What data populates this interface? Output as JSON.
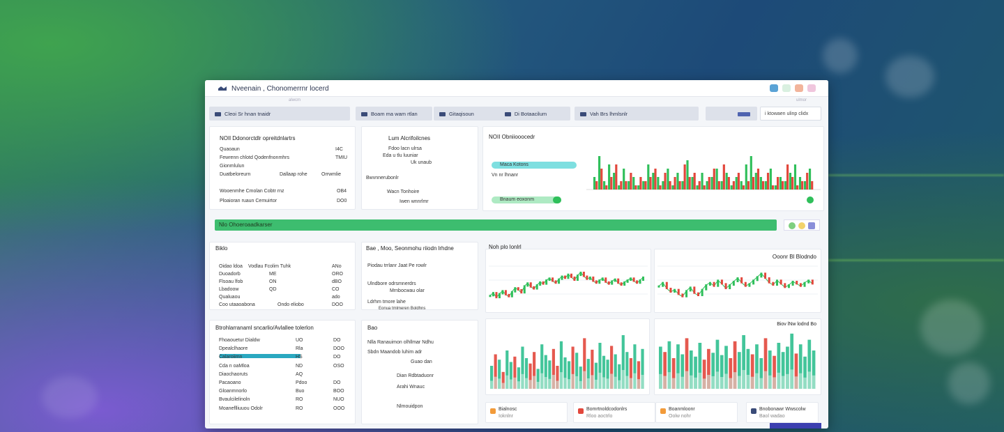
{
  "window": {
    "title": "Nveenain , Chonomerrnr locerd",
    "subtab_left": "alwcm",
    "subtab_right": "ulmor"
  },
  "navbar": {
    "items": [
      "Cleoi Sr hnan tnaidr",
      "Boam ma wam rtlan",
      "Gitaqisoun",
      "Di Botaacilum",
      "Vah Brs lhmlsnlr"
    ],
    "search_placeholder": "i ktowaen ulinp clidx"
  },
  "panel_overview": {
    "title": "NOIl Ddonorctdlr opreitdnlartrs",
    "rows": [
      {
        "label": "Quaoaun",
        "value": "I4C"
      },
      {
        "label": "Fewrenn chlotd Qodenfnonmhrs",
        "value": "TMIU"
      },
      {
        "label": "Gionmlulun",
        "value": ""
      },
      {
        "label": "Duatbeloreurn",
        "value": ""
      },
      {
        "label": "Dallaap rohe",
        "value": "Orrwmlie"
      },
      {
        "label": "Wooenmhe Cmolan Cobtr rnz",
        "value": "OB4"
      },
      {
        "label": "Ploaioran ruaun Cemuirtor",
        "value": "DO0"
      }
    ]
  },
  "panel_mid_top": {
    "title": "Lum Alcrifoilcnes",
    "rows": [
      "Fdoo lacn ulrsa",
      "Eda u tlu luuniar",
      "Uk unaub",
      "Bwvnnerubonlr",
      "Wacn Tonhoire",
      "Iwen wnnrlmr"
    ]
  },
  "panel_chart_top": {
    "title": "NOII Obniiooocedr",
    "tags": [
      "Maca Kotons",
      "Vn nr lhnanr",
      "Bnaum eoxonm"
    ]
  },
  "progress": {
    "label": "Nlo Ohoeroaadkarser",
    "percent": 100
  },
  "panel_left_mid": {
    "title": "Biklo",
    "rows": [
      {
        "label": "Oidao ldoa",
        "v1": "Vodlau Fcolim Tuhk",
        "v2": "ANo"
      },
      {
        "label": "Duoadorb",
        "v1": "ME",
        "v2": "ORO"
      },
      {
        "label": "Flsoau lfob",
        "v1": "ON",
        "v2": "dBO"
      },
      {
        "label": "Lbadoow",
        "v1": "QD",
        "v2": "CO"
      },
      {
        "label": "Qualuaou",
        "v1": "",
        "v2": "ado"
      },
      {
        "label": "Coo utaaoabona",
        "v1": "Ondo eliobo",
        "v2": "DOO"
      }
    ]
  },
  "panel_mid_mid": {
    "title": "Bae , Moo, Seonmohu riiodn lrhdne",
    "rows": [
      "Piodau trrlanr Jaat Pe rowlr",
      "Ulndbore odrsmnerdrs",
      "Mrnbocwau olar",
      "Ldrhm tmore lahe",
      "Eonua tmlmeren Boldhns"
    ]
  },
  "chart_candles_title": "Noh plo lonlrl",
  "chart_candles_right_label": "Ooonr Bl Blodndo",
  "chart_bars_right_label": "Biov lNw lodnd Bo",
  "panel_left_bottom": {
    "title": "Btrohlarranaml sncarlio/Avlallee tolerlon",
    "rows": [
      {
        "label": "Fhoaouetur Dialdw",
        "v1": "UO",
        "v2": "DO"
      },
      {
        "label": "Dpealclhaore",
        "v1": "Rla",
        "v2": "DOO"
      },
      {
        "label": "Calaroiimn",
        "v1": "HS",
        "v2": "DO"
      },
      {
        "label": "Cda n oaMloa",
        "v1": "ND",
        "v2": "OSO"
      },
      {
        "label": "Diaochaoruts",
        "v1": "AQ",
        "v2": ""
      },
      {
        "label": "Pacaoano",
        "v1": "Pdoo",
        "v2": "DO"
      },
      {
        "label": "Gloanmnorlo",
        "v1": "Buo",
        "v2": "BOO"
      },
      {
        "label": "Bvaulcilelinoln",
        "v1": "RO",
        "v2": "NUO"
      },
      {
        "label": "Moaneflliuuou Odolr",
        "v1": "RO",
        "v2": "OOO"
      }
    ]
  },
  "panel_mid_bottom": {
    "title": "Bao",
    "rows": [
      "Nlla Ranauimon olhllmar Ndhu",
      "Sbdn Maandob luhim adr",
      "Guao dan",
      "Dian Rdbtaduonr",
      "Arahi Wnauc",
      "Nlmouidpon"
    ]
  },
  "bottom_tiles": [
    {
      "label": "Bialnosc",
      "sub": "Ioknlnr"
    },
    {
      "label": "Bomrtnoldcodonlrs",
      "sub": "Rloo aoctrlo"
    },
    {
      "label": "Boanmloonr",
      "sub": "Oolw nohr"
    },
    {
      "label": "Bnobonawr Wwscolw",
      "sub": "Baol wadao"
    }
  ],
  "colors": {
    "accent_green": "#2fbf5a",
    "accent_red": "#e2473c",
    "accent_teal": "#42c6c9",
    "navbar_bg": "#dde1ea"
  },
  "chart_data": [
    {
      "type": "bar",
      "title": "NOII Obniiooocedr",
      "series": [
        {
          "values": [
            3,
            8,
            2,
            6,
            4,
            1,
            5,
            2,
            3,
            1,
            2,
            6,
            4,
            3,
            2,
            5,
            1,
            4,
            2,
            7,
            3,
            1,
            4,
            2,
            3,
            5,
            2,
            4,
            1,
            3,
            2,
            6,
            8,
            4,
            3,
            2,
            5,
            1,
            3,
            2,
            4,
            6,
            3,
            2,
            5
          ]
        },
        {
          "values": [
            2,
            5,
            1,
            3,
            6,
            2,
            2,
            4,
            1,
            3,
            2,
            3,
            5,
            1,
            4,
            2,
            3,
            2,
            6,
            3,
            4,
            2,
            1,
            3,
            5,
            2,
            6,
            3,
            2,
            4,
            1,
            2,
            3,
            5,
            2,
            4,
            1,
            3,
            2,
            6,
            3,
            1,
            2,
            4,
            2
          ]
        }
      ],
      "colors": [
        "#2fbf5a",
        "#e2473c"
      ]
    },
    {
      "type": "line",
      "title": "Noh plo lonlrl",
      "values": [
        42,
        45,
        40,
        44,
        47,
        43,
        41,
        46,
        50,
        48,
        45,
        52,
        55,
        51,
        49,
        53,
        56,
        54,
        58,
        60,
        57,
        55,
        59,
        62,
        60,
        64,
        61,
        58,
        63,
        66,
        62,
        59,
        61,
        57,
        55,
        58,
        60,
        56,
        54,
        57,
        59,
        55,
        53,
        56,
        58,
        60,
        57,
        55,
        58,
        61
      ]
    },
    {
      "type": "line",
      "title": "Ooonr Bl Blodndo",
      "values": [
        55,
        58,
        53,
        50,
        52,
        48,
        46,
        51,
        54,
        49,
        47,
        52,
        56,
        58,
        55,
        60,
        57,
        53,
        56,
        59,
        62,
        58,
        55,
        57,
        60,
        63,
        66,
        62,
        58,
        56,
        60,
        57,
        54,
        56,
        59,
        57,
        55,
        58,
        60,
        57
      ]
    },
    {
      "type": "bar",
      "title": "",
      "values": [
        30,
        45,
        38,
        22,
        50,
        35,
        42,
        28,
        55,
        40,
        33,
        48,
        26,
        58,
        44,
        37,
        52,
        30,
        62,
        41,
        36,
        55,
        47,
        29,
        66,
        39,
        51,
        34,
        60,
        43,
        38,
        56,
        45,
        32,
        70,
        48,
        40,
        58,
        36,
        52
      ]
    },
    {
      "type": "bar",
      "title": "Biov lNw lodnd Bo",
      "values": [
        55,
        48,
        62,
        40,
        58,
        45,
        66,
        50,
        42,
        60,
        38,
        52,
        47,
        64,
        44,
        56,
        40,
        62,
        48,
        70,
        52,
        45,
        58,
        40,
        66,
        50,
        43,
        60,
        48,
        55,
        72,
        46,
        58,
        42,
        64,
        50
      ]
    }
  ]
}
